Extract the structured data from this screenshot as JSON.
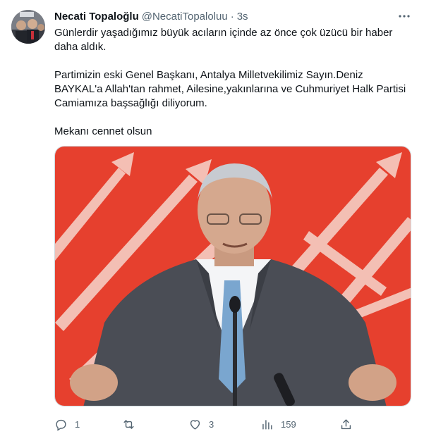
{
  "tweet": {
    "author_name": "Necati Topaloğlu",
    "handle": "@NecatiTopaloluu",
    "separator": "·",
    "time": "3s",
    "text_lines": [
      "Günlerdir yaşadığımız büyük acıların içinde az önce çok üzücü bir haber daha aldık.",
      "Partimizin eski Genel Başkanı, Antalya Milletvekilimiz Sayın.Deniz BAYKAL'a Allah'tan rahmet, Ailesine,yakınlarına ve Cuhmuriyet Halk Partisi Camiamıza başsağlığı diliyorum.",
      "Mekanı cennet olsun"
    ]
  },
  "actions": {
    "reply_count": "1",
    "retweet_count": "",
    "like_count": "3",
    "views_count": "159"
  },
  "icons": [
    "more-icon",
    "reply-icon",
    "retweet-icon",
    "like-icon",
    "views-icon",
    "share-icon"
  ],
  "colors": {
    "text": "#0f1419",
    "secondary": "#536471",
    "border": "#cfd9de",
    "photo_bg": "#e6402e"
  }
}
